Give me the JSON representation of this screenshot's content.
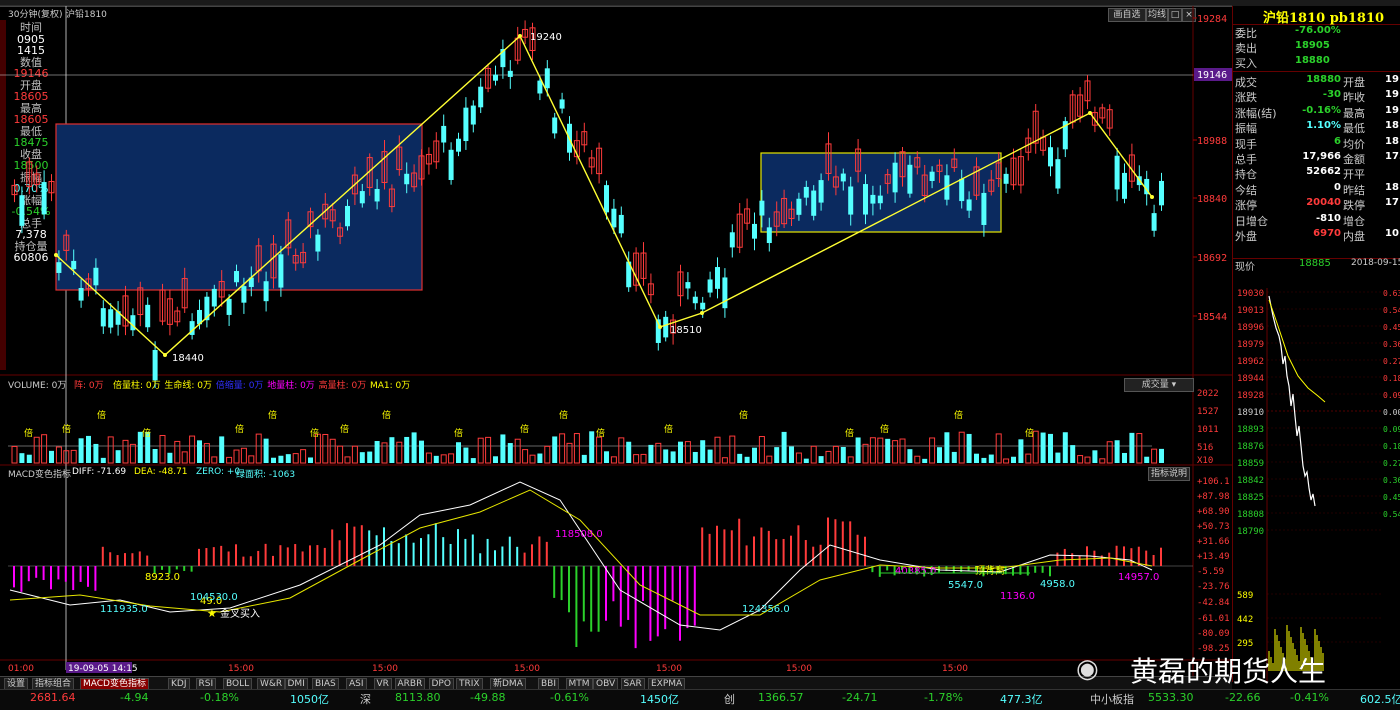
{
  "header": {
    "period": "30分钟(复权)",
    "symbol": "沪铅1810",
    "btn_draw": "画自选",
    "btn_avg": "均线",
    "chart_title": "沪铅1810 pb1810"
  },
  "left_panel": [
    {
      "text": "时间",
      "color": "#c0c0c0"
    },
    {
      "text": "0905",
      "color": "#ffffff"
    },
    {
      "text": "1415",
      "color": "#ffffff"
    },
    {
      "text": "数值",
      "color": "#c0c0c0"
    },
    {
      "text": "19146",
      "color": "#ff3b3b"
    },
    {
      "text": "开盘",
      "color": "#c0c0c0"
    },
    {
      "text": "18605",
      "color": "#ff3b3b"
    },
    {
      "text": "最高",
      "color": "#c0c0c0"
    },
    {
      "text": "18605",
      "color": "#ff3b3b"
    },
    {
      "text": "最低",
      "color": "#c0c0c0"
    },
    {
      "text": "18475",
      "color": "#2bd12b"
    },
    {
      "text": "收盘",
      "color": "#c0c0c0"
    },
    {
      "text": "18500",
      "color": "#2bd12b"
    },
    {
      "text": "振幅",
      "color": "#c0c0c0"
    },
    {
      "text": "0.70%",
      "color": "#5ff"
    },
    {
      "text": "涨幅",
      "color": "#c0c0c0"
    },
    {
      "text": "-0.54%",
      "color": "#2bd12b"
    },
    {
      "text": "总手",
      "color": "#c0c0c0"
    },
    {
      "text": "7,378",
      "color": "#ffffff"
    },
    {
      "text": "持仓量",
      "color": "#c0c0c0"
    },
    {
      "text": "60806",
      "color": "#ffffff"
    }
  ],
  "price_axis": [
    "19284",
    "19146",
    "18988",
    "18840",
    "18692",
    "18544"
  ],
  "price_highlight": "19146",
  "price_annotations": {
    "high": "19240",
    "low1": "18440",
    "low2": "18510"
  },
  "volume": {
    "label": "VOLUME: 0万",
    "items": [
      "阵: 0万",
      "倍量柱: 0万",
      "生命线: 0万",
      "倍缩量: 0万",
      "地量柱: 0万",
      "高量柱: 0万",
      "MA1: 0万"
    ],
    "dropdown": "成交量",
    "axis": [
      "2022",
      "1527",
      "1011",
      "516",
      "X10"
    ],
    "marker": "倍"
  },
  "macd": {
    "label": "MACD变色指标",
    "diff": "DIFF: -71.69",
    "dea": "DEA: -48.71",
    "zero": "ZERO: +0",
    "cum": "绿面积: -1063",
    "explain_btn": "指标说明",
    "axis": [
      "106.1",
      "87.98",
      "68.90",
      "50.73",
      "31.66",
      "13.49",
      "5.59",
      "23.76",
      "42.84",
      "61.01",
      "80.09",
      "98.25"
    ],
    "annotations": [
      "8923.0",
      "49.0",
      "111935.0",
      "104530.0",
      "金叉买入",
      "118508.0",
      "124356.0",
      "40385.0",
      "顶背离",
      "1136.0",
      "5547.0",
      "4958.0",
      "14957.0"
    ]
  },
  "time_axis": [
    "01:00",
    "19-09-05 14:15",
    "15:00",
    "15:00",
    "15:00",
    "15:00",
    "15:00",
    "15:00"
  ],
  "tabs": [
    "设置",
    "指标组合",
    "MACD变色指标",
    "KDJ",
    "RSI",
    "BOLL",
    "W&R",
    "DMI",
    "BIAS",
    "ASI",
    "VR",
    "ARBR",
    "DPO",
    "TRIX",
    "新DMA",
    "BBI",
    "MTM",
    "OBV",
    "SAR",
    "EXPMA"
  ],
  "right_panel": {
    "title": "沪铅1810 pb1810",
    "rows1": [
      {
        "l": "委比",
        "v": "-76.00%",
        "c": "#2bd12b"
      },
      {
        "l": "卖出",
        "v": "18905",
        "c": "#2bd12b"
      },
      {
        "l": "买入",
        "v": "18880",
        "c": "#2bd12b"
      }
    ],
    "rows2": [
      {
        "l": "成交",
        "v": "18880",
        "c": "#2bd12b",
        "l2": "开盘",
        "v2": "19"
      },
      {
        "l": "涨跌",
        "v": "-30",
        "c": "#2bd12b",
        "l2": "昨收",
        "v2": "19"
      },
      {
        "l": "涨幅(结)",
        "v": "-0.16%",
        "c": "#2bd12b",
        "l2": "最高",
        "v2": "19"
      },
      {
        "l": "振幅",
        "v": "1.10%",
        "c": "#5ff",
        "l2": "最低",
        "v2": "18"
      },
      {
        "l": "现手",
        "v": "6",
        "c": "#2bd12b",
        "l2": "均价",
        "v2": "18"
      },
      {
        "l": "总手",
        "v": "17,966",
        "c": "#ffffff",
        "l2": "金额",
        "v2": "17.0"
      },
      {
        "l": "持仓",
        "v": "52662",
        "c": "#ffffff",
        "l2": "开平",
        "v2": ""
      },
      {
        "l": "今结",
        "v": "0",
        "c": "#ffffff",
        "l2": "昨结",
        "v2": "18"
      },
      {
        "l": "涨停",
        "v": "20040",
        "c": "#ff3b3b",
        "l2": "跌停",
        "v2": "17"
      },
      {
        "l": "日增仓",
        "v": "-810",
        "c": "#ffffff",
        "l2": "增仓",
        "v2": ""
      },
      {
        "l": "外盘",
        "v": "6970",
        "c": "#ff3b3b",
        "l2": "内盘",
        "v2": "10"
      }
    ],
    "now_label": "现价",
    "now_price": "18885",
    "now_date": "2018-09-15",
    "mini_axis": [
      "19030",
      "19013",
      "18996",
      "18979",
      "18962",
      "18944",
      "18928",
      "18910",
      "18893",
      "18876",
      "18859",
      "18842",
      "18825",
      "18808",
      "18790",
      "589",
      "442",
      "295"
    ],
    "mini_pct": [
      "0.63",
      "0.54",
      "0.45",
      "0.36",
      "0.27",
      "0.18",
      "0.09",
      "0.00",
      "0.09",
      "0.18",
      "0.27",
      "0.36",
      "0.45",
      "0.54"
    ]
  },
  "status_bar": [
    {
      "t": "2681.64",
      "c": "#ff3b3b"
    },
    {
      "t": "-4.94",
      "c": "#2bd12b"
    },
    {
      "t": "-0.18%",
      "c": "#2bd12b"
    },
    {
      "t": "1050亿",
      "c": "#5ff"
    },
    {
      "t": "深",
      "c": "#ccc"
    },
    {
      "t": "8113.80",
      "c": "#2bd12b"
    },
    {
      "t": "-49.88",
      "c": "#2bd12b"
    },
    {
      "t": "-0.61%",
      "c": "#2bd12b"
    },
    {
      "t": "1450亿",
      "c": "#5ff"
    },
    {
      "t": "创",
      "c": "#ccc"
    },
    {
      "t": "1366.57",
      "c": "#2bd12b"
    },
    {
      "t": "-24.71",
      "c": "#2bd12b"
    },
    {
      "t": "-1.78%",
      "c": "#2bd12b"
    },
    {
      "t": "477.3亿",
      "c": "#5ff"
    },
    {
      "t": "中小板指",
      "c": "#ccc"
    },
    {
      "t": "5533.30",
      "c": "#2bd12b"
    },
    {
      "t": "-22.66",
      "c": "#2bd12b"
    },
    {
      "t": "-0.41%",
      "c": "#2bd12b"
    },
    {
      "t": "602.5亿",
      "c": "#5ff"
    }
  ],
  "watermark": "黄磊的期货人生"
}
